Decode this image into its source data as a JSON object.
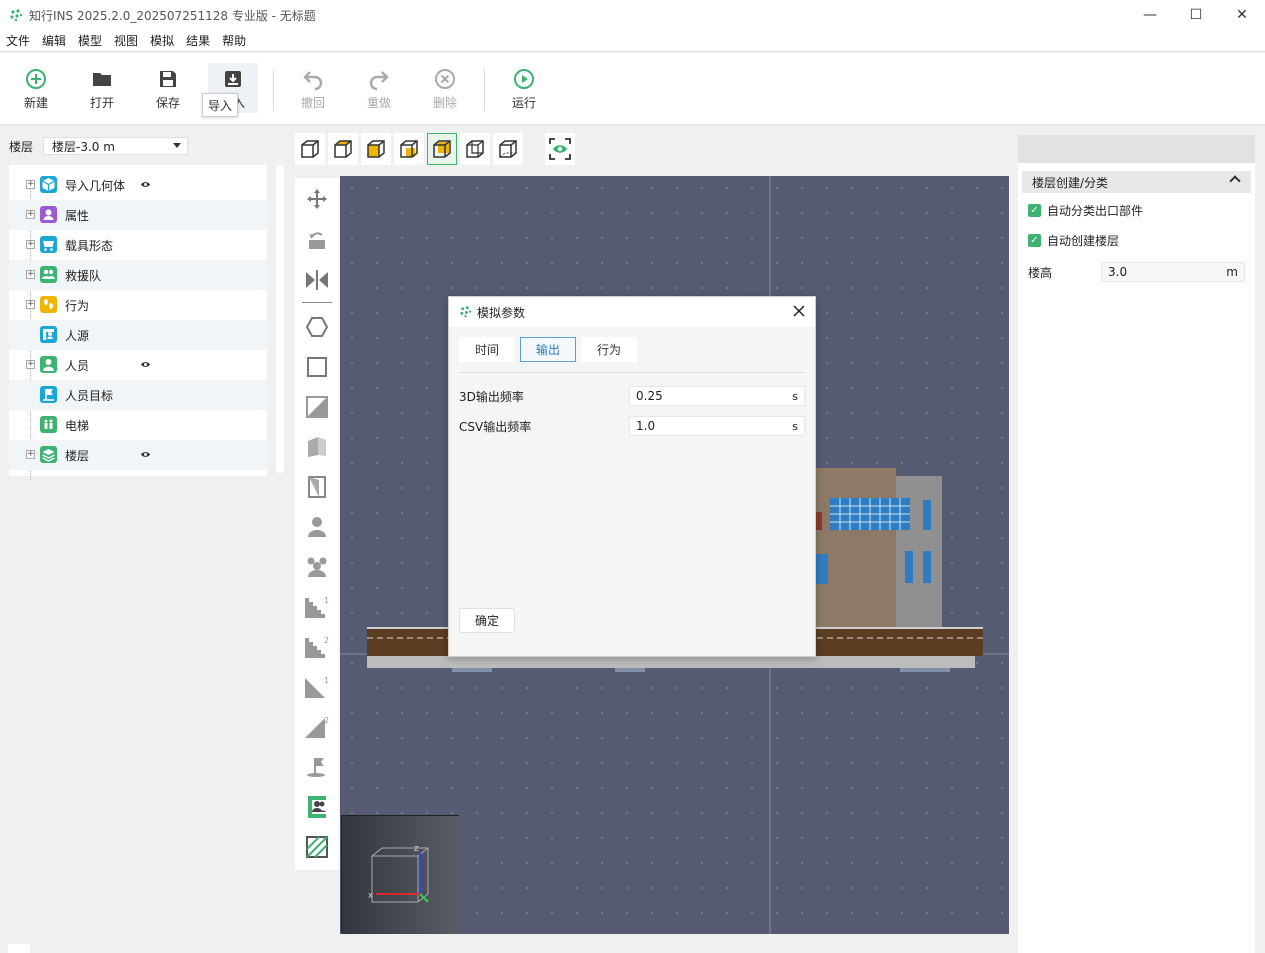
{
  "window": {
    "title": "知行INS 2025.2.0_202507251128 专业版 - 无标题",
    "minimize": "—",
    "maximize": "☐",
    "close": "✕"
  },
  "menu": [
    "文件",
    "编辑",
    "模型",
    "视图",
    "模拟",
    "结果",
    "帮助"
  ],
  "toolbar": {
    "new": "新建",
    "open": "打开",
    "save": "保存",
    "import": "导入",
    "undo": "撤回",
    "redo": "重做",
    "delete": "删除",
    "run": "运行",
    "tooltip": "导入"
  },
  "floor_selector": {
    "label": "楼层",
    "value": "楼层-3.0 m"
  },
  "tree": [
    {
      "label": "导入几何体",
      "icon": "cube-icon",
      "color": "#1ba7d6",
      "expandable": true,
      "eye": true
    },
    {
      "label": "属性",
      "icon": "person-card-icon",
      "color": "#9b59d6",
      "expandable": true,
      "eye": false
    },
    {
      "label": "载具形态",
      "icon": "cart-icon",
      "color": "#1ba7d6",
      "expandable": true,
      "eye": false
    },
    {
      "label": "救援队",
      "icon": "team-icon",
      "color": "#3cb371",
      "expandable": true,
      "eye": false
    },
    {
      "label": "行为",
      "icon": "footsteps-icon",
      "color": "#f0b400",
      "expandable": true,
      "eye": false
    },
    {
      "label": "人源",
      "icon": "source-icon",
      "color": "#1ba7d6",
      "expandable": false,
      "eye": false
    },
    {
      "label": "人员",
      "icon": "person-icon",
      "color": "#3cb371",
      "expandable": true,
      "eye": true
    },
    {
      "label": "人员目标",
      "icon": "flag-icon",
      "color": "#1ba7d6",
      "expandable": false,
      "eye": false
    },
    {
      "label": "电梯",
      "icon": "elevator-icon",
      "color": "#3cb371",
      "expandable": false,
      "eye": false
    },
    {
      "label": "楼层",
      "icon": "layers-icon",
      "color": "#3cb371",
      "expandable": true,
      "eye": true
    }
  ],
  "right_panel": {
    "section_title": "楼层创建/分类",
    "check1": "自动分类出口部件",
    "check2": "自动创建楼层",
    "height_label": "楼高",
    "height_value": "3.0",
    "height_unit": "m"
  },
  "dialog": {
    "title": "模拟参数",
    "tabs": [
      "时间",
      "输出",
      "行为"
    ],
    "active_tab": "输出",
    "rows": [
      {
        "label": "3D输出频率",
        "value": "0.25",
        "unit": "s"
      },
      {
        "label": "CSV输出频率",
        "value": "1.0",
        "unit": "s"
      }
    ],
    "ok": "确定"
  },
  "minimap_axes": {
    "z": "Z",
    "x": "X"
  },
  "colors": {
    "accent_green": "#3cb371",
    "viewport_bg": "#565a73",
    "tab_active_blue": "#5a9fd6"
  }
}
